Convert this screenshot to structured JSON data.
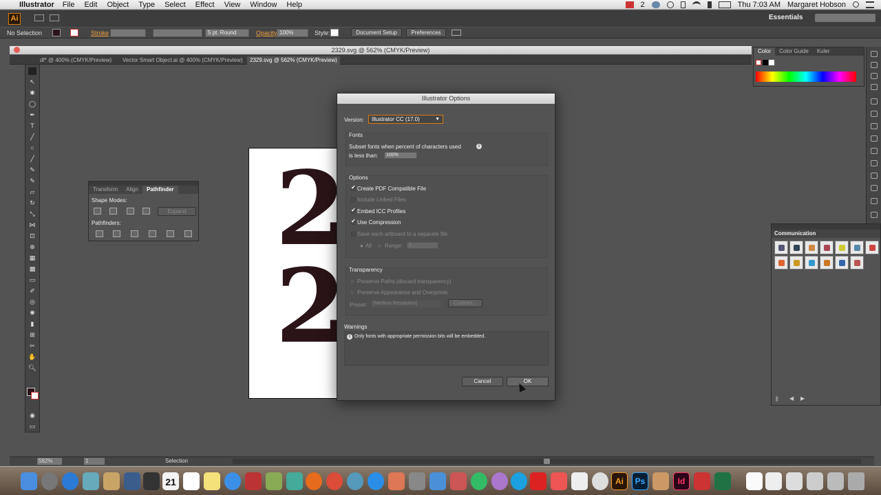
{
  "menubar": {
    "app_name": "Illustrator",
    "items": [
      "File",
      "Edit",
      "Object",
      "Type",
      "Select",
      "Effect",
      "View",
      "Window",
      "Help"
    ],
    "clock": "Thu 7:03 AM",
    "user": "Margaret Hobson",
    "badge_count": "2"
  },
  "appbar": {
    "logo": "Ai",
    "workspace": "Essentials"
  },
  "controlbar": {
    "selection_state": "No Selection",
    "stroke_label": "Stroke",
    "brush_value": "5 pt. Round",
    "opacity_label": "Opacity:",
    "opacity_value": "100%",
    "style_label": "Style:",
    "document_setup": "Document Setup",
    "preferences": "Preferences"
  },
  "document": {
    "title": "2329.svg @ 562% (CMYK/Preview)",
    "tabs": [
      "df* @ 400% (CMYK/Preview)",
      "Vector Smart Object.ai @ 400% (CMYK/Preview)",
      "2329.svg @ 562% (CMYK/Preview)"
    ],
    "glyphs": [
      "2",
      "2"
    ]
  },
  "pathfinder_panel": {
    "tabs": [
      "Transform",
      "Align",
      "Pathfinder"
    ],
    "shape_modes_label": "Shape Modes:",
    "expand_label": "Expand",
    "pathfinders_label": "Pathfinders:"
  },
  "dialog": {
    "title": "Illustrator Options",
    "version_label": "Version:",
    "version_value": "Illustrator CC (17.0)",
    "fonts_title": "Fonts",
    "subset_line1": "Subset fonts when percent of characters used",
    "subset_line2": "is less than:",
    "subset_value": "100%",
    "options_title": "Options",
    "opt_create_pdf": "Create PDF Compatible File",
    "opt_linked": "Include Linked Files",
    "opt_icc": "Embed ICC Profiles",
    "opt_compression": "Use Compression",
    "opt_artboards": "Save each artboard to a separate file",
    "opt_all": "All",
    "opt_range": "Range:",
    "opt_range_value": "1",
    "transparency_title": "Transparency",
    "tr_preserve_paths": "Preserve Paths (discard transparency)",
    "tr_preserve_appearance": "Preserve Appearance and Overprints",
    "preset_label": "Preset:",
    "preset_value": "[Medium Resolution]",
    "custom_button": "Custom...",
    "warnings_title": "Warnings",
    "warning_text": "Only fonts with appropriate permission bits will be embedded.",
    "cancel": "Cancel",
    "ok": "OK"
  },
  "color_panel": {
    "tabs": [
      "Color",
      "Color Guide",
      "Kuler"
    ]
  },
  "communication_panel": {
    "title": "Communication"
  },
  "statusbar": {
    "zoom": "562%",
    "page": "1",
    "tool": "Selection"
  },
  "dock": {
    "calendar_day": "21",
    "ai_label": "Ai",
    "ps_label": "Ps",
    "id_label": "Id"
  },
  "colors": {
    "accent_orange": "#d97a12",
    "panel_bg": "#535353",
    "glyph_color": "#2b1418"
  }
}
